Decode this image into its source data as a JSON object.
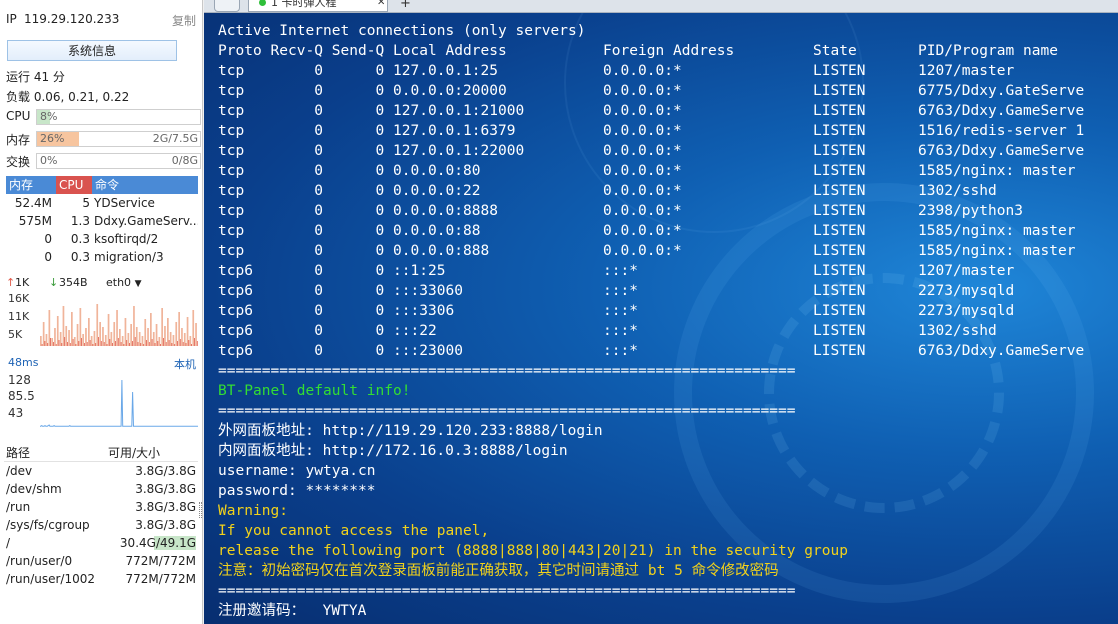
{
  "sidebar": {
    "ip_label": "IP",
    "ip_value": "119.29.120.233",
    "copy_label": "复制",
    "sysinfo_button": "系统信息",
    "uptime": "运行 41 分",
    "load": "负载 0.06, 0.21, 0.22",
    "cpu": {
      "label": "CPU",
      "pct_text": "8%",
      "level": 0.08,
      "total": ""
    },
    "mem": {
      "label": "内存",
      "pct_text": "26%",
      "level": 0.26,
      "total": "2G/7.5G"
    },
    "swap": {
      "label": "交换",
      "pct_text": "0%",
      "level": 0.0,
      "total": "0/8G"
    },
    "proc_header": {
      "mem": "内存",
      "cpu": "CPU",
      "cmd": "命令"
    },
    "processes": [
      {
        "mem": "52.4M",
        "cpu": "5",
        "cmd": "YDService"
      },
      {
        "mem": "575M",
        "cpu": "1.3",
        "cmd": "Ddxy.GameServ..."
      },
      {
        "mem": "0",
        "cpu": "0.3",
        "cmd": "ksoftirqd/2"
      },
      {
        "mem": "0",
        "cpu": "0.3",
        "cmd": "migration/3"
      }
    ],
    "net": {
      "up": "1K",
      "down": "354B",
      "iface": "eth0",
      "ticks": [
        "16K",
        "11K",
        "5K"
      ],
      "bars_up": [
        2,
        5,
        3,
        8,
        4,
        2,
        6,
        3,
        9,
        4,
        3,
        7,
        2,
        5,
        8,
        3,
        4,
        6,
        2,
        3,
        9,
        5,
        4,
        2,
        7,
        3,
        5,
        8,
        4,
        2,
        6,
        3,
        5,
        9,
        4,
        3,
        2,
        6,
        4,
        7,
        3,
        5,
        2,
        8,
        4,
        6,
        3,
        2,
        5,
        7,
        4,
        3,
        6,
        2,
        8,
        5
      ],
      "bars_down": [
        10,
        24,
        12,
        36,
        8,
        18,
        30,
        14,
        40,
        20,
        16,
        34,
        9,
        22,
        38,
        12,
        18,
        28,
        10,
        15,
        42,
        24,
        19,
        11,
        32,
        14,
        24,
        36,
        17,
        10,
        28,
        13,
        22,
        40,
        19,
        14,
        10,
        27,
        18,
        33,
        14,
        22,
        9,
        38,
        20,
        28,
        14,
        11,
        24,
        34,
        18,
        13,
        29,
        10,
        36,
        23
      ]
    },
    "ping": {
      "latency": "48ms",
      "location": "本机",
      "ticks": [
        "128",
        "85.5",
        "43"
      ],
      "values": [
        43,
        43,
        44,
        43,
        43,
        43,
        44,
        43,
        43,
        43,
        44,
        45,
        43,
        43,
        43,
        43,
        43,
        44,
        43,
        43,
        43,
        43,
        43,
        43,
        43,
        43,
        43,
        43,
        43,
        43,
        43,
        43,
        43,
        43,
        43,
        43,
        44,
        43,
        43,
        43,
        43,
        43,
        43,
        43,
        43,
        43,
        43,
        43,
        43,
        43,
        43,
        43,
        43,
        43,
        43,
        43,
        43,
        43,
        43,
        43,
        43,
        43,
        43,
        43,
        43,
        43,
        43,
        43,
        43,
        43,
        43,
        43,
        43,
        43,
        43,
        43,
        43,
        43,
        43,
        43,
        43,
        43,
        43,
        43,
        43,
        43,
        43,
        43,
        43,
        43,
        43,
        43,
        43,
        43,
        43,
        43,
        43,
        43,
        43,
        120,
        43,
        43,
        43,
        43,
        43,
        43,
        43,
        43,
        43,
        43,
        43,
        43,
        100,
        43,
        43,
        43,
        43,
        43,
        43,
        43,
        43,
        43,
        43,
        43,
        43,
        43,
        43,
        43,
        43,
        43,
        43,
        43,
        43,
        43,
        43,
        43,
        43,
        43,
        43,
        43,
        43,
        43,
        43,
        43,
        43,
        43,
        43,
        43,
        43,
        43,
        43,
        43,
        43,
        43,
        43,
        43,
        43,
        43,
        43,
        43,
        43,
        43,
        43,
        43,
        43,
        43,
        43,
        43,
        43,
        43,
        43,
        43,
        43,
        43,
        43,
        43,
        43,
        43,
        43,
        43,
        43,
        43,
        43,
        43,
        43,
        43,
        43,
        43,
        43,
        43,
        43,
        43
      ]
    },
    "disk_header": {
      "path": "路径",
      "size": "可用/大小"
    },
    "disks": [
      {
        "path": "/dev",
        "size": "3.8G/3.8G"
      },
      {
        "path": "/dev/shm",
        "size": "3.8G/3.8G"
      },
      {
        "path": "/run",
        "size": "3.8G/3.8G"
      },
      {
        "path": "/sys/fs/cgroup",
        "size": "3.8G/3.8G"
      },
      {
        "path": "/",
        "size": "30.4G/49.1G",
        "highlight": true
      },
      {
        "path": "/run/user/0",
        "size": "772M/772M"
      },
      {
        "path": "/run/user/1002",
        "size": "772M/772M"
      }
    ]
  },
  "tabs": {
    "active_title": "1 卡时弹人程",
    "add_label": "+",
    "close_label": "✕"
  },
  "terminal": {
    "lines": [
      {
        "text": "Active Internet connections (only servers)",
        "color": "#ffffff"
      },
      {
        "text": "Proto Recv-Q Send-Q Local Address           Foreign Address         State       PID/Program name",
        "color": "#ffffff"
      },
      {
        "text": "tcp        0      0 127.0.0.1:25            0.0.0.0:*               LISTEN      1207/master",
        "color": "#ffffff"
      },
      {
        "text": "tcp        0      0 0.0.0.0:20000           0.0.0.0:*               LISTEN      6775/Ddxy.GateServe",
        "color": "#ffffff"
      },
      {
        "text": "tcp        0      0 127.0.0.1:21000         0.0.0.0:*               LISTEN      6763/Ddxy.GameServe",
        "color": "#ffffff"
      },
      {
        "text": "tcp        0      0 127.0.0.1:6379          0.0.0.0:*               LISTEN      1516/redis-server 1",
        "color": "#ffffff"
      },
      {
        "text": "tcp        0      0 127.0.0.1:22000         0.0.0.0:*               LISTEN      6763/Ddxy.GameServe",
        "color": "#ffffff"
      },
      {
        "text": "tcp        0      0 0.0.0.0:80              0.0.0.0:*               LISTEN      1585/nginx: master",
        "color": "#ffffff"
      },
      {
        "text": "tcp        0      0 0.0.0.0:22              0.0.0.0:*               LISTEN      1302/sshd",
        "color": "#ffffff"
      },
      {
        "text": "tcp        0      0 0.0.0.0:8888            0.0.0.0:*               LISTEN      2398/python3",
        "color": "#ffffff"
      },
      {
        "text": "tcp        0      0 0.0.0.0:88              0.0.0.0:*               LISTEN      1585/nginx: master",
        "color": "#ffffff"
      },
      {
        "text": "tcp        0      0 0.0.0.0:888             0.0.0.0:*               LISTEN      1585/nginx: master",
        "color": "#ffffff"
      },
      {
        "text": "tcp6       0      0 ::1:25                  :::*                    LISTEN      1207/master",
        "color": "#ffffff"
      },
      {
        "text": "tcp6       0      0 :::33060                :::*                    LISTEN      2273/mysqld",
        "color": "#ffffff"
      },
      {
        "text": "tcp6       0      0 :::3306                 :::*                    LISTEN      2273/mysqld",
        "color": "#ffffff"
      },
      {
        "text": "tcp6       0      0 :::22                   :::*                    LISTEN      1302/sshd",
        "color": "#ffffff"
      },
      {
        "text": "tcp6       0      0 :::23000                :::*                    LISTEN      6763/Ddxy.GameServe",
        "color": "#ffffff"
      },
      {
        "text": "==================================================================",
        "color": "#ffffff"
      },
      {
        "text": "BT-Panel default info!",
        "color": "#33dd33"
      },
      {
        "text": "==================================================================",
        "color": "#ffffff"
      },
      {
        "text": "外网面板地址: http://119.29.120.233:8888/login",
        "color": "#ffffff"
      },
      {
        "text": "内网面板地址: http://172.16.0.3:8888/login",
        "color": "#ffffff"
      },
      {
        "text": "username: ywtya.cn",
        "color": "#ffffff"
      },
      {
        "text": "password: ********",
        "color": "#ffffff"
      },
      {
        "text": "Warning:",
        "color": "#f2d21b"
      },
      {
        "text": "If you cannot access the panel,",
        "color": "#f2d21b"
      },
      {
        "text": "release the following port (8888|888|80|443|20|21) in the security group",
        "color": "#f2d21b"
      },
      {
        "text": "注意：初始密码仅在首次登录面板前能正确获取，其它时间请通过 bt 5 命令修改密码",
        "color": "#f2d21b"
      },
      {
        "text": "==================================================================",
        "color": "#ffffff"
      },
      {
        "text": "注册邀请码：  YWTYA",
        "color": "#ffffff"
      }
    ]
  },
  "colors": {
    "proc_mem_header": "#4a8ad6",
    "proc_cpu_header": "#d9534f",
    "proc_cmd_header": "#4a8ad6",
    "cpu_fill": "#c8e6c9",
    "mem_fill": "#f7c59f",
    "net_up": "#e05a4a",
    "net_down": "#3a9a3a",
    "net_bars": "#f0b49a",
    "ping_line": "#6aa8e8",
    "tab_dot": "#2fbf3a",
    "disk_highlight": "#c8e6c9"
  }
}
